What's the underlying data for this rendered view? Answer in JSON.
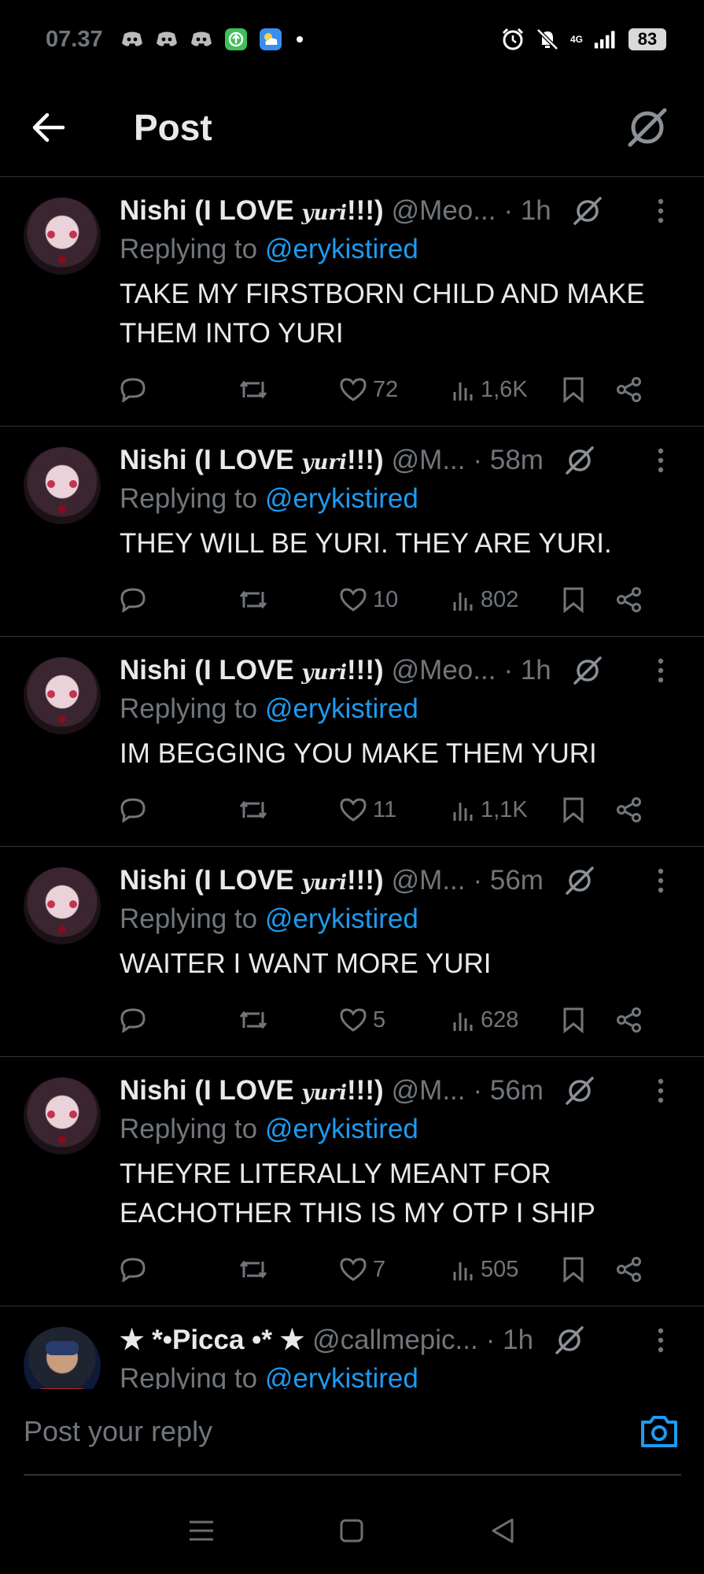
{
  "status_bar": {
    "time": "07.37",
    "network": "4G",
    "battery": "83"
  },
  "header": {
    "title": "Post"
  },
  "posts": [
    {
      "name_prefix": "Nishi (I LOVE ",
      "name_styled": "yuri",
      "name_suffix": "!!!)",
      "handle": "@Meo...",
      "time": "· 1h",
      "reply_label": "Replying to ",
      "reply_mention": "@erykistired",
      "text": "TAKE MY FIRSTBORN CHILD AND MAKE THEM INTO YURI",
      "likes": "72",
      "views": "1,6K"
    },
    {
      "name_prefix": "Nishi (I LOVE ",
      "name_styled": "yuri",
      "name_suffix": "!!!)",
      "handle": "@M...",
      "time": "· 58m",
      "reply_label": "Replying to ",
      "reply_mention": "@erykistired",
      "text": "THEY WILL BE YURI. THEY ARE YURI.",
      "likes": "10",
      "views": "802"
    },
    {
      "name_prefix": "Nishi (I LOVE ",
      "name_styled": "yuri",
      "name_suffix": "!!!)",
      "handle": "@Meo...",
      "time": "· 1h",
      "reply_label": "Replying to ",
      "reply_mention": "@erykistired",
      "text": "IM BEGGING YOU MAKE THEM YURI",
      "likes": "11",
      "views": "1,1K"
    },
    {
      "name_prefix": "Nishi (I LOVE ",
      "name_styled": "yuri",
      "name_suffix": "!!!)",
      "handle": "@M...",
      "time": "· 56m",
      "reply_label": "Replying to ",
      "reply_mention": "@erykistired",
      "text": "WAITER I WANT MORE YURI",
      "likes": "5",
      "views": "628"
    },
    {
      "name_prefix": "Nishi (I LOVE ",
      "name_styled": "yuri",
      "name_suffix": "!!!)",
      "handle": "@M...",
      "time": "· 56m",
      "reply_label": "Replying to ",
      "reply_mention": "@erykistired",
      "text": "THEYRE LITERALLY MEANT FOR EACHOTHER THIS IS MY OTP I SHIP",
      "likes": "7",
      "views": "505"
    },
    {
      "name_prefix": "★ *•Picca •* ★",
      "name_styled": "",
      "name_suffix": "",
      "handle": "@callmepic...",
      "time": "· 1h",
      "reply_label": "Replying to ",
      "reply_mention": "@erykistired",
      "text": "",
      "likes": "",
      "views": ""
    }
  ],
  "reply_bar": {
    "placeholder": "Post your reply"
  },
  "colors": {
    "background": "#000000",
    "text": "#e7e9ea",
    "muted": "#71767b",
    "accent": "#1d9bf0",
    "divider": "#2f3336"
  },
  "icons": {
    "back": "arrow-left-icon",
    "grok": "grok-icon",
    "more": "more-vertical-icon",
    "reply": "reply-icon",
    "repost": "repost-icon",
    "like": "heart-icon",
    "views": "views-icon",
    "bookmark": "bookmark-icon",
    "share": "share-icon",
    "camera": "camera-icon"
  }
}
